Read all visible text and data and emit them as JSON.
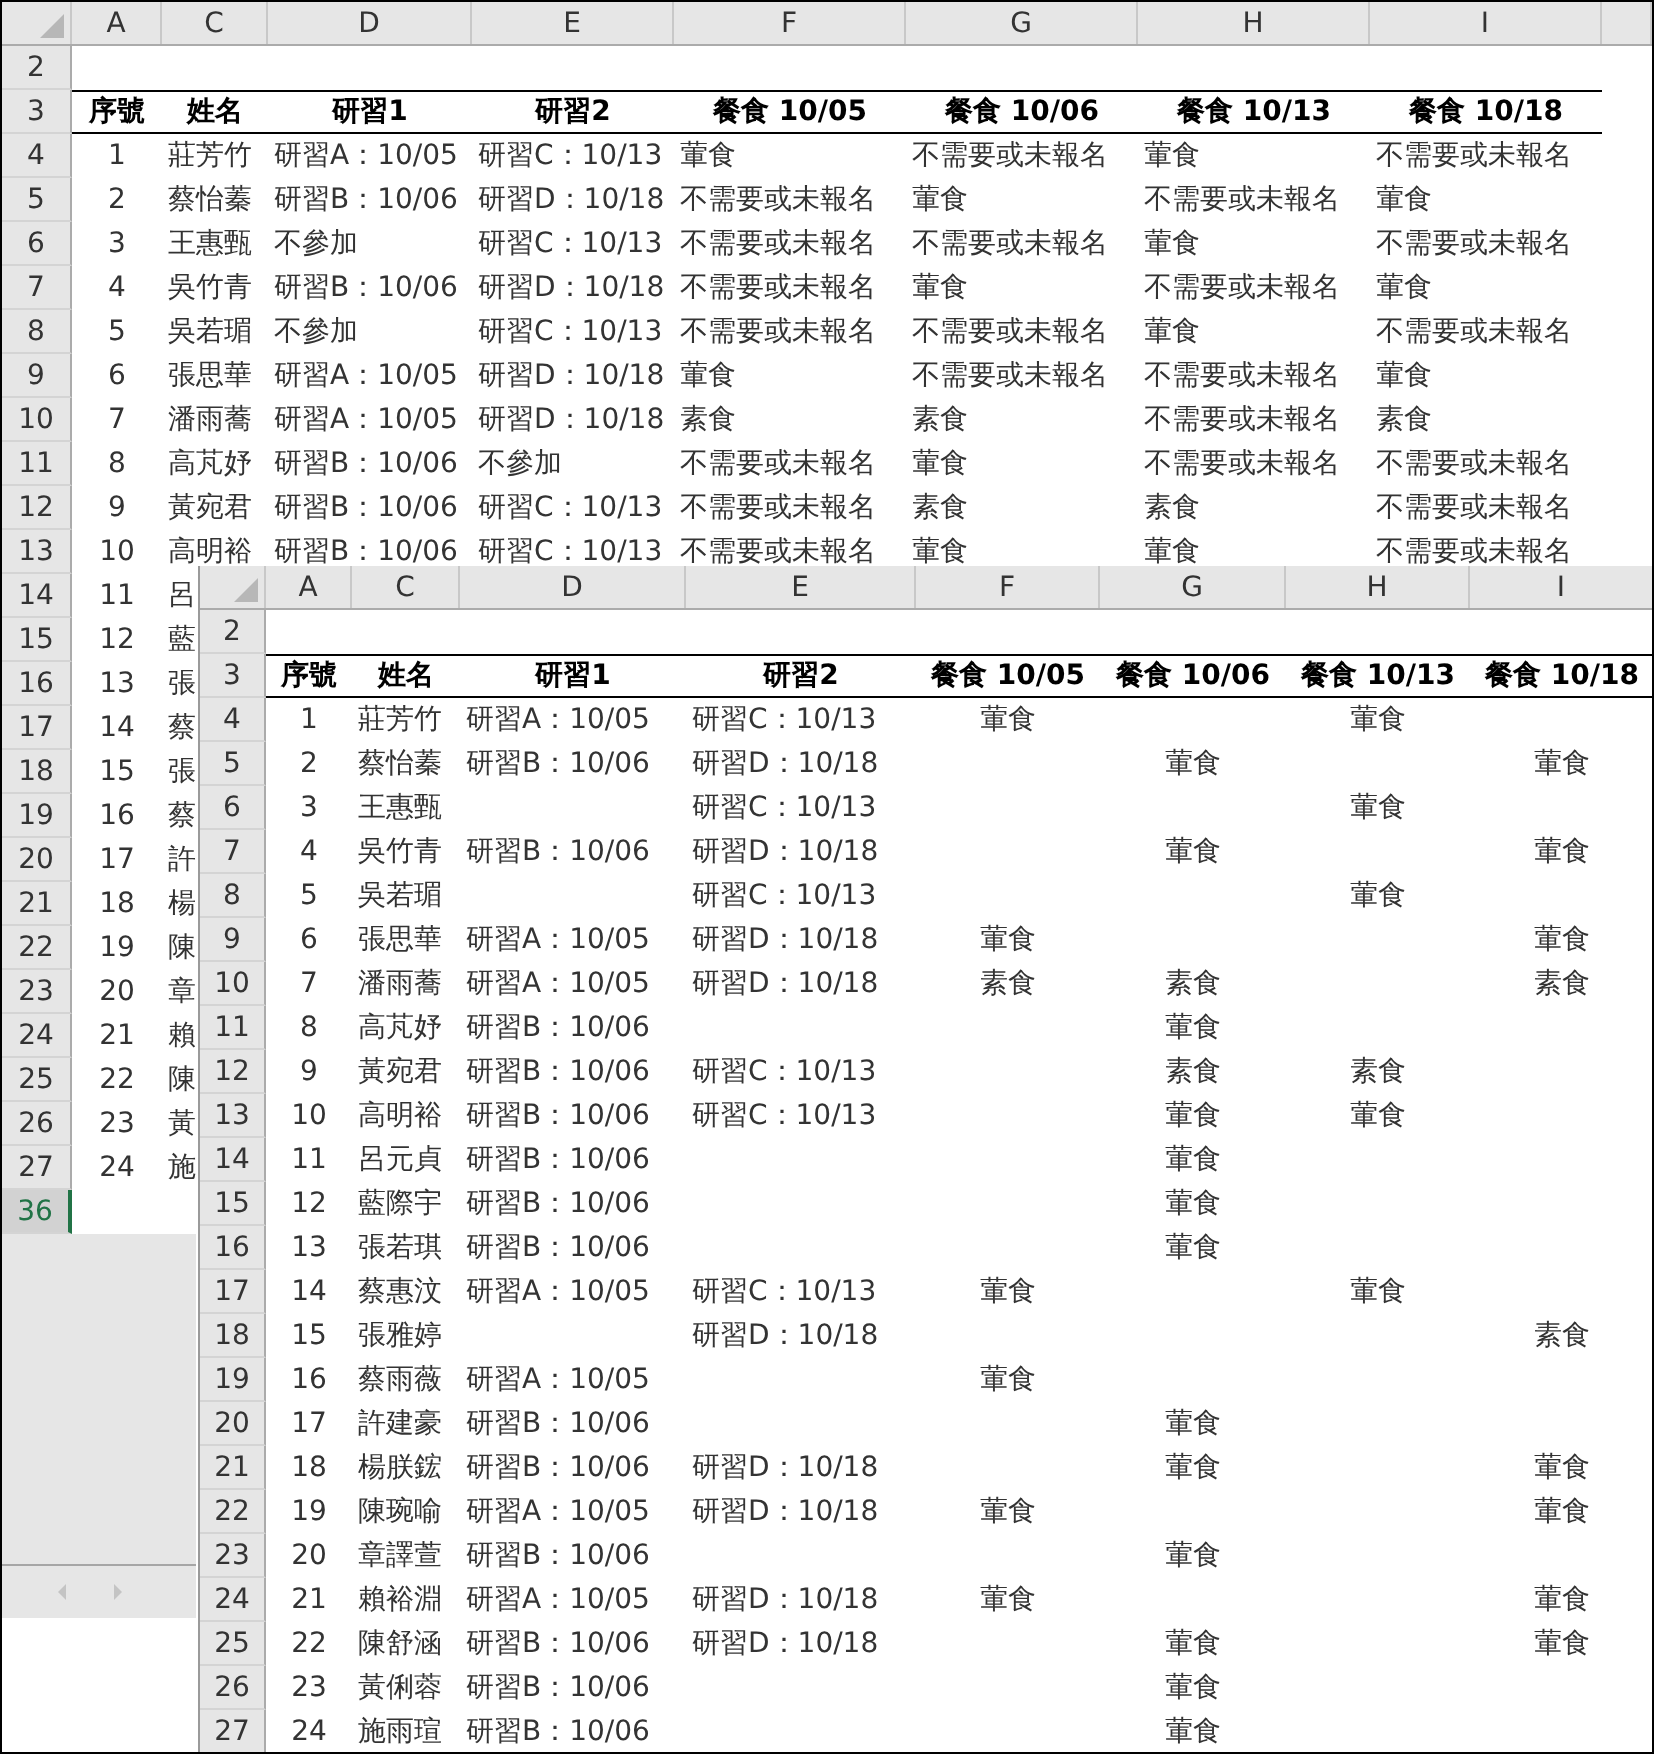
{
  "back_sheet": {
    "columns": [
      "A",
      "C",
      "D",
      "E",
      "F",
      "G",
      "H",
      "I"
    ],
    "rows": [
      {
        "number": "2",
        "selected": false,
        "kind": "blank"
      },
      {
        "number": "3",
        "selected": false,
        "kind": "header",
        "cells": [
          "序號",
          "姓名",
          "研習1",
          "研習2",
          "餐食 10/05",
          "餐食 10/06",
          "餐食 10/13",
          "餐食 10/18"
        ]
      },
      {
        "number": "4",
        "selected": false,
        "kind": "data",
        "cells": [
          "1",
          "莊芳竹",
          "研習A：10/05",
          "研習C：10/13",
          "葷食",
          "不需要或未報名",
          "葷食",
          "不需要或未報名"
        ]
      },
      {
        "number": "5",
        "selected": false,
        "kind": "data",
        "cells": [
          "2",
          "蔡怡蓁",
          "研習B：10/06",
          "研習D：10/18",
          "不需要或未報名",
          "葷食",
          "不需要或未報名",
          "葷食"
        ]
      },
      {
        "number": "6",
        "selected": false,
        "kind": "data",
        "cells": [
          "3",
          "王惠甄",
          "不參加",
          "研習C：10/13",
          "不需要或未報名",
          "不需要或未報名",
          "葷食",
          "不需要或未報名"
        ]
      },
      {
        "number": "7",
        "selected": false,
        "kind": "data",
        "cells": [
          "4",
          "吳竹青",
          "研習B：10/06",
          "研習D：10/18",
          "不需要或未報名",
          "葷食",
          "不需要或未報名",
          "葷食"
        ]
      },
      {
        "number": "8",
        "selected": false,
        "kind": "data",
        "cells": [
          "5",
          "吳若瑂",
          "不參加",
          "研習C：10/13",
          "不需要或未報名",
          "不需要或未報名",
          "葷食",
          "不需要或未報名"
        ]
      },
      {
        "number": "9",
        "selected": false,
        "kind": "data",
        "cells": [
          "6",
          "張思華",
          "研習A：10/05",
          "研習D：10/18",
          "葷食",
          "不需要或未報名",
          "不需要或未報名",
          "葷食"
        ]
      },
      {
        "number": "10",
        "selected": false,
        "kind": "data",
        "cells": [
          "7",
          "潘雨蕎",
          "研習A：10/05",
          "研習D：10/18",
          "素食",
          "素食",
          "不需要或未報名",
          "素食"
        ]
      },
      {
        "number": "11",
        "selected": false,
        "kind": "data",
        "cells": [
          "8",
          "高芃妤",
          "研習B：10/06",
          "不參加",
          "不需要或未報名",
          "葷食",
          "不需要或未報名",
          "不需要或未報名"
        ]
      },
      {
        "number": "12",
        "selected": false,
        "kind": "data",
        "cells": [
          "9",
          "黃宛君",
          "研習B：10/06",
          "研習C：10/13",
          "不需要或未報名",
          "素食",
          "素食",
          "不需要或未報名"
        ]
      },
      {
        "number": "13",
        "selected": false,
        "kind": "data",
        "cells": [
          "10",
          "高明裕",
          "研習B：10/06",
          "研習C：10/13",
          "不需要或未報名",
          "葷食",
          "葷食",
          "不需要或未報名"
        ]
      },
      {
        "number": "14",
        "selected": false,
        "kind": "data",
        "cells": [
          "11",
          "呂"
        ]
      },
      {
        "number": "15",
        "selected": false,
        "kind": "data",
        "cells": [
          "12",
          "藍"
        ]
      },
      {
        "number": "16",
        "selected": false,
        "kind": "data",
        "cells": [
          "13",
          "張"
        ]
      },
      {
        "number": "17",
        "selected": false,
        "kind": "data",
        "cells": [
          "14",
          "蔡"
        ]
      },
      {
        "number": "18",
        "selected": false,
        "kind": "data",
        "cells": [
          "15",
          "張"
        ]
      },
      {
        "number": "19",
        "selected": false,
        "kind": "data",
        "cells": [
          "16",
          "蔡"
        ]
      },
      {
        "number": "20",
        "selected": false,
        "kind": "data",
        "cells": [
          "17",
          "許"
        ]
      },
      {
        "number": "21",
        "selected": false,
        "kind": "data",
        "cells": [
          "18",
          "楊"
        ]
      },
      {
        "number": "22",
        "selected": false,
        "kind": "data",
        "cells": [
          "19",
          "陳"
        ]
      },
      {
        "number": "23",
        "selected": false,
        "kind": "data",
        "cells": [
          "20",
          "章"
        ]
      },
      {
        "number": "24",
        "selected": false,
        "kind": "data",
        "cells": [
          "21",
          "賴"
        ]
      },
      {
        "number": "25",
        "selected": false,
        "kind": "data",
        "cells": [
          "22",
          "陳"
        ]
      },
      {
        "number": "26",
        "selected": false,
        "kind": "data",
        "cells": [
          "23",
          "黃"
        ]
      },
      {
        "number": "27",
        "selected": false,
        "kind": "data",
        "cells": [
          "24",
          "施"
        ]
      },
      {
        "number": "36",
        "selected": true,
        "kind": "blank"
      }
    ]
  },
  "front_sheet": {
    "columns": [
      "A",
      "C",
      "D",
      "E",
      "F",
      "G",
      "H",
      "I"
    ],
    "rows": [
      {
        "number": "2",
        "selected": false,
        "kind": "blank"
      },
      {
        "number": "3",
        "selected": false,
        "kind": "header",
        "cells": [
          "序號",
          "姓名",
          "研習1",
          "研習2",
          "餐食 10/05",
          "餐食 10/06",
          "餐食 10/13",
          "餐食 10/18"
        ]
      },
      {
        "number": "4",
        "selected": false,
        "kind": "data",
        "cells": [
          "1",
          "莊芳竹",
          "研習A：10/05",
          "研習C：10/13",
          "葷食",
          null,
          "葷食",
          null
        ]
      },
      {
        "number": "5",
        "selected": false,
        "kind": "data",
        "cells": [
          "2",
          "蔡怡蓁",
          "研習B：10/06",
          "研習D：10/18",
          null,
          "葷食",
          null,
          "葷食"
        ]
      },
      {
        "number": "6",
        "selected": false,
        "kind": "data",
        "cells": [
          "3",
          "王惠甄",
          null,
          "研習C：10/13",
          null,
          null,
          "葷食",
          null
        ]
      },
      {
        "number": "7",
        "selected": false,
        "kind": "data",
        "cells": [
          "4",
          "吳竹青",
          "研習B：10/06",
          "研習D：10/18",
          null,
          "葷食",
          null,
          "葷食"
        ]
      },
      {
        "number": "8",
        "selected": false,
        "kind": "data",
        "cells": [
          "5",
          "吳若瑂",
          null,
          "研習C：10/13",
          null,
          null,
          "葷食",
          null
        ]
      },
      {
        "number": "9",
        "selected": false,
        "kind": "data",
        "cells": [
          "6",
          "張思華",
          "研習A：10/05",
          "研習D：10/18",
          "葷食",
          null,
          null,
          "葷食"
        ]
      },
      {
        "number": "10",
        "selected": false,
        "kind": "data",
        "cells": [
          "7",
          "潘雨蕎",
          "研習A：10/05",
          "研習D：10/18",
          "素食",
          "素食",
          null,
          "素食"
        ]
      },
      {
        "number": "11",
        "selected": false,
        "kind": "data",
        "cells": [
          "8",
          "高芃妤",
          "研習B：10/06",
          null,
          null,
          "葷食",
          null,
          null
        ]
      },
      {
        "number": "12",
        "selected": false,
        "kind": "data",
        "cells": [
          "9",
          "黃宛君",
          "研習B：10/06",
          "研習C：10/13",
          null,
          "素食",
          "素食",
          null
        ]
      },
      {
        "number": "13",
        "selected": false,
        "kind": "data",
        "cells": [
          "10",
          "高明裕",
          "研習B：10/06",
          "研習C：10/13",
          null,
          "葷食",
          "葷食",
          null
        ]
      },
      {
        "number": "14",
        "selected": false,
        "kind": "data",
        "cells": [
          "11",
          "呂元貞",
          "研習B：10/06",
          null,
          null,
          "葷食",
          null,
          null
        ]
      },
      {
        "number": "15",
        "selected": false,
        "kind": "data",
        "cells": [
          "12",
          "藍際宇",
          "研習B：10/06",
          null,
          null,
          "葷食",
          null,
          null
        ]
      },
      {
        "number": "16",
        "selected": false,
        "kind": "data",
        "cells": [
          "13",
          "張若琪",
          "研習B：10/06",
          null,
          null,
          "葷食",
          null,
          null
        ]
      },
      {
        "number": "17",
        "selected": false,
        "kind": "data",
        "cells": [
          "14",
          "蔡惠汶",
          "研習A：10/05",
          "研習C：10/13",
          "葷食",
          null,
          "葷食",
          null
        ]
      },
      {
        "number": "18",
        "selected": false,
        "kind": "data",
        "cells": [
          "15",
          "張雅婷",
          null,
          "研習D：10/18",
          null,
          null,
          null,
          "素食"
        ]
      },
      {
        "number": "19",
        "selected": false,
        "kind": "data",
        "cells": [
          "16",
          "蔡雨薇",
          "研習A：10/05",
          null,
          "葷食",
          null,
          null,
          null
        ]
      },
      {
        "number": "20",
        "selected": false,
        "kind": "data",
        "cells": [
          "17",
          "許建豪",
          "研習B：10/06",
          null,
          null,
          "葷食",
          null,
          null
        ]
      },
      {
        "number": "21",
        "selected": false,
        "kind": "data",
        "cells": [
          "18",
          "楊朕鋐",
          "研習B：10/06",
          "研習D：10/18",
          null,
          "葷食",
          null,
          "葷食"
        ]
      },
      {
        "number": "22",
        "selected": false,
        "kind": "data",
        "cells": [
          "19",
          "陳琬喻",
          "研習A：10/05",
          "研習D：10/18",
          "葷食",
          null,
          null,
          "葷食"
        ]
      },
      {
        "number": "23",
        "selected": false,
        "kind": "data",
        "cells": [
          "20",
          "章譯萱",
          "研習B：10/06",
          null,
          null,
          "葷食",
          null,
          null
        ]
      },
      {
        "number": "24",
        "selected": false,
        "kind": "data",
        "cells": [
          "21",
          "賴裕淵",
          "研習A：10/05",
          "研習D：10/18",
          "葷食",
          null,
          null,
          "葷食"
        ]
      },
      {
        "number": "25",
        "selected": false,
        "kind": "data",
        "cells": [
          "22",
          "陳舒涵",
          "研習B：10/06",
          "研習D：10/18",
          null,
          "葷食",
          null,
          "葷食"
        ]
      },
      {
        "number": "26",
        "selected": false,
        "kind": "data",
        "cells": [
          "23",
          "黃俐蓉",
          "研習B：10/06",
          null,
          null,
          "葷食",
          null,
          null
        ]
      },
      {
        "number": "27",
        "selected": false,
        "kind": "data",
        "cells": [
          "24",
          "施雨瑄",
          "研習B：10/06",
          null,
          null,
          "葷食",
          null,
          null
        ]
      }
    ]
  }
}
